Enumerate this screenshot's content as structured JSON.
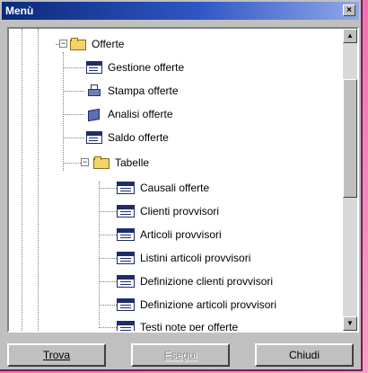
{
  "window": {
    "title": "Menù",
    "close_glyph": "×"
  },
  "tree": {
    "root": {
      "label": "Offerte",
      "expander": "−",
      "icon": "folder-open-icon"
    },
    "items": [
      {
        "label": "Gestione offerte",
        "icon": "window-icon"
      },
      {
        "label": "Stampa offerte",
        "icon": "printer-icon"
      },
      {
        "label": "Analisi offerte",
        "icon": "cube-icon"
      },
      {
        "label": "Saldo offerte",
        "icon": "window-icon"
      }
    ],
    "sub": {
      "label": "Tabelle",
      "expander": "−",
      "icon": "folder-open-icon"
    },
    "sub_items": [
      {
        "label": "Causali offerte",
        "icon": "table-icon"
      },
      {
        "label": "Clienti provvisori",
        "icon": "table-icon"
      },
      {
        "label": "Articoli provvisori",
        "icon": "table-icon"
      },
      {
        "label": "Listini articoli provvisori",
        "icon": "table-icon"
      },
      {
        "label": "Definizione clienti provvisori",
        "icon": "table-icon"
      },
      {
        "label": "Definizione articoli provvisori",
        "icon": "table-icon"
      },
      {
        "label": "Testi note per offerte",
        "icon": "table-icon"
      }
    ]
  },
  "scrollbar": {
    "up_glyph": "▲",
    "down_glyph": "▼"
  },
  "buttons": {
    "find": "Trova",
    "execute": "Esegui",
    "close": "Chiudi"
  }
}
